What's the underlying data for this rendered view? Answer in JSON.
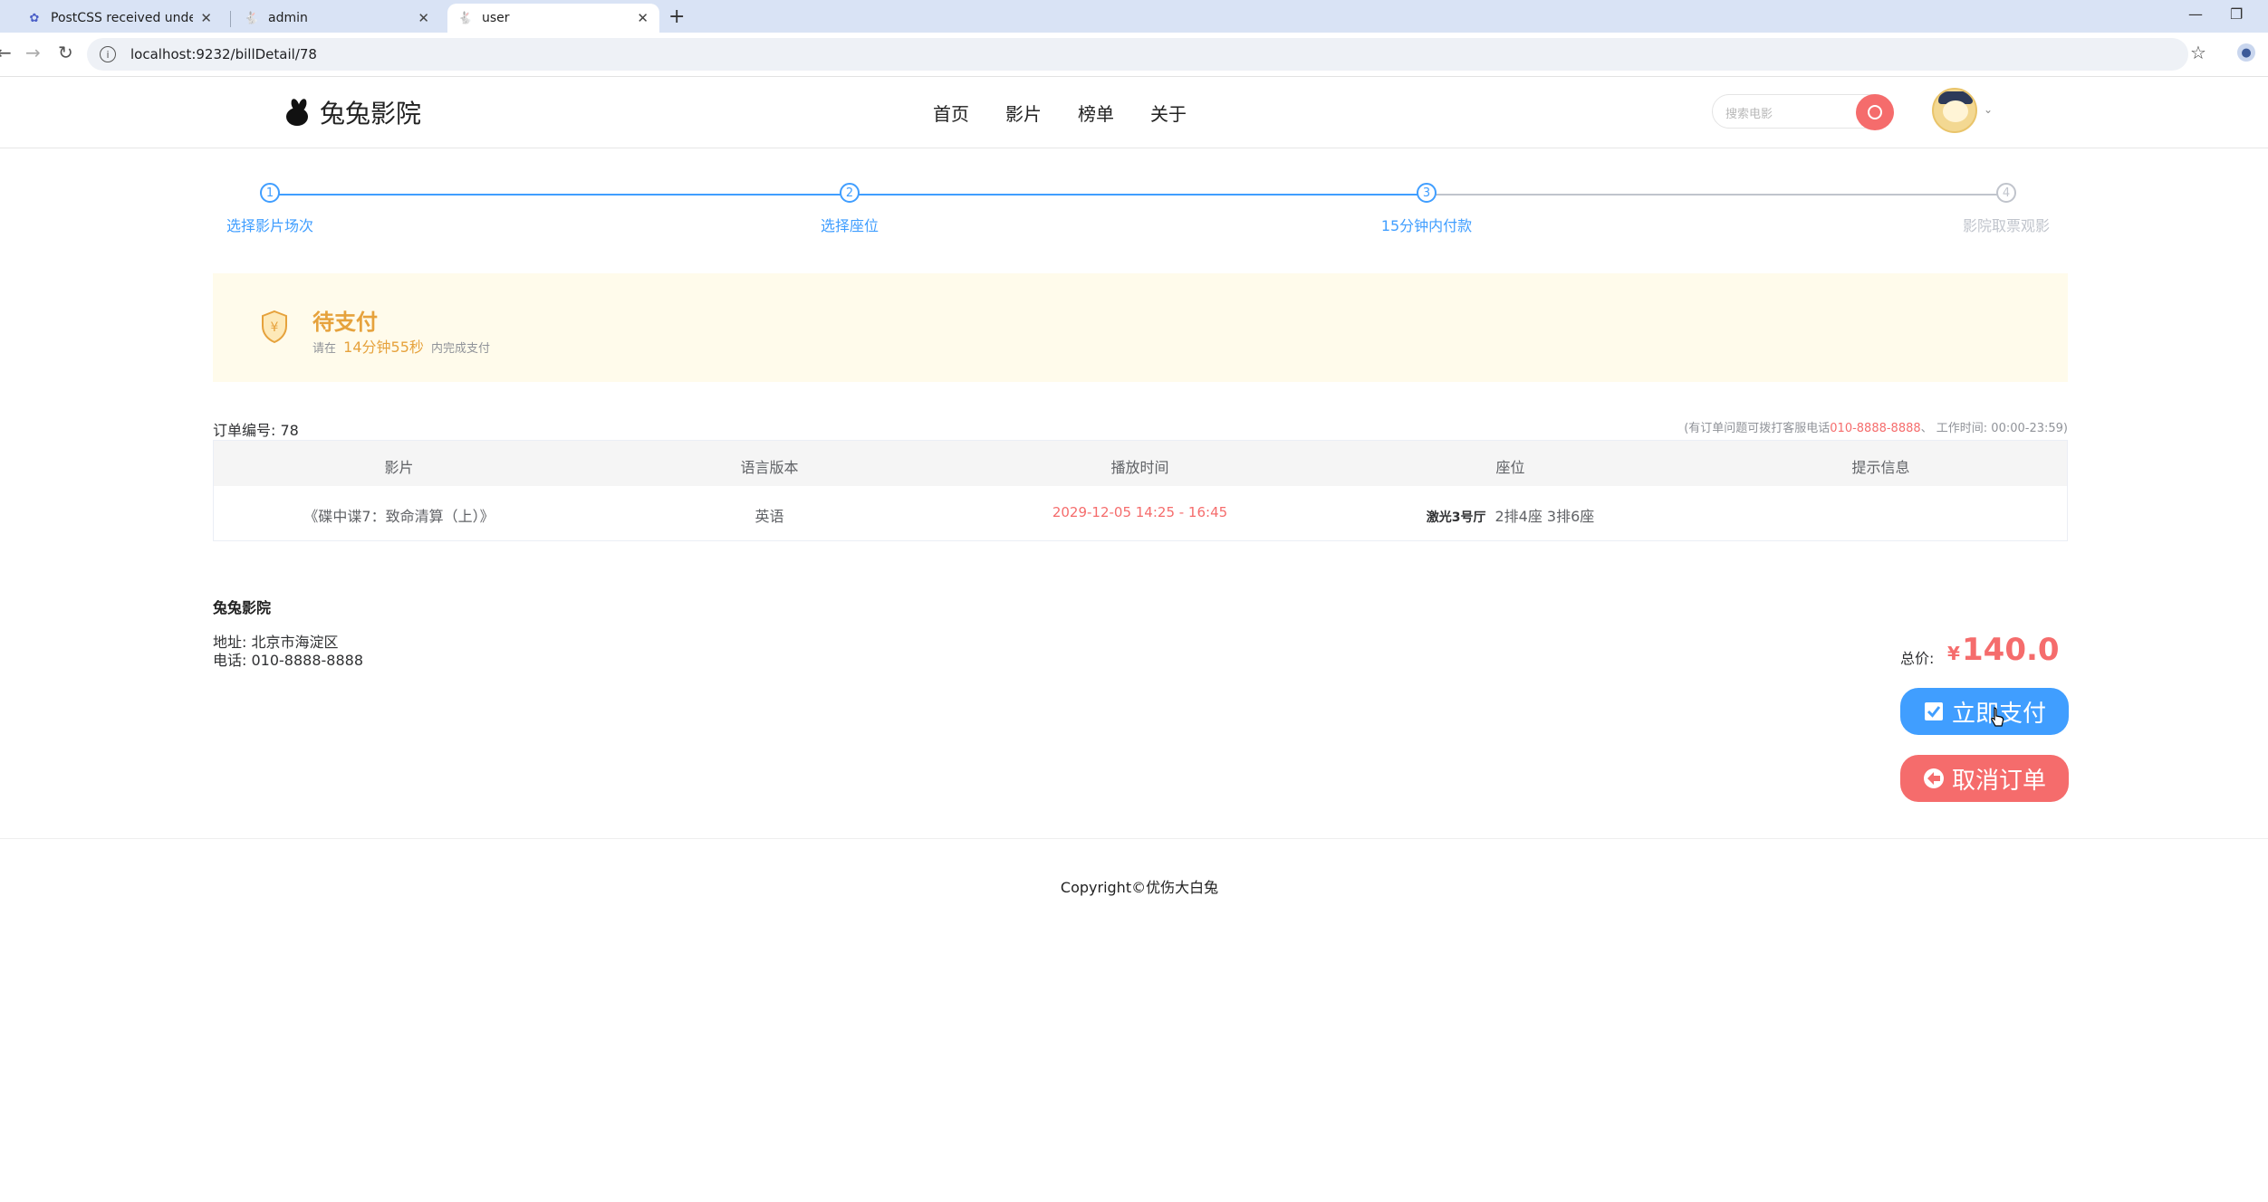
{
  "browser": {
    "tabs": [
      {
        "title": "PostCSS received undefined i",
        "icon": "vue-icon",
        "active": false
      },
      {
        "title": "admin",
        "icon": "rabbit-icon",
        "active": false
      },
      {
        "title": "user",
        "icon": "rabbit-icon",
        "active": true
      }
    ],
    "new_tab": "+",
    "url": "localhost:9232/billDetail/78"
  },
  "header": {
    "logo_text": "兔兔影院",
    "nav": [
      "首页",
      "影片",
      "榜单",
      "关于"
    ],
    "search_placeholder": "搜索电影"
  },
  "steps": [
    {
      "num": "1",
      "label": "选择影片场次",
      "done": true
    },
    {
      "num": "2",
      "label": "选择座位",
      "done": true
    },
    {
      "num": "3",
      "label": "15分钟内付款",
      "done": true
    },
    {
      "num": "4",
      "label": "影院取票观影",
      "done": false
    }
  ],
  "status": {
    "title": "待支付",
    "sub_prefix": "请在",
    "countdown": "14分钟55秒",
    "sub_suffix": "内完成支付"
  },
  "order": {
    "number_label": "订单编号: 78",
    "hotline_prefix": "(有订单问题可拨打客服电话",
    "hotline_phone": "010-8888-8888",
    "hotline_suffix": "、 工作时间: 00:00-23:59)",
    "columns": [
      "影片",
      "语言版本",
      "播放时间",
      "座位",
      "提示信息"
    ],
    "row": {
      "movie": "《碟中谍7：致命清算（上）》",
      "language": "英语",
      "time": "2029-12-05 14:25 - 16:45",
      "hall": "激光3号厅",
      "seats": "2排4座 3排6座",
      "tip": ""
    }
  },
  "cinema": {
    "name": "兔兔影院",
    "address": "地址: 北京市海淀区",
    "phone": "电话: 010-8888-8888"
  },
  "payment": {
    "total_label": "总价:",
    "currency": "¥",
    "total": "140.0",
    "pay_button": "立即支付",
    "cancel_button": "取消订单"
  },
  "footer": {
    "copyright": "Copyright©优伤大白兔"
  },
  "colors": {
    "primary": "#409eff",
    "danger": "#f56c6c",
    "warning": "#e6a23c",
    "status_bg": "#fffbeb"
  }
}
